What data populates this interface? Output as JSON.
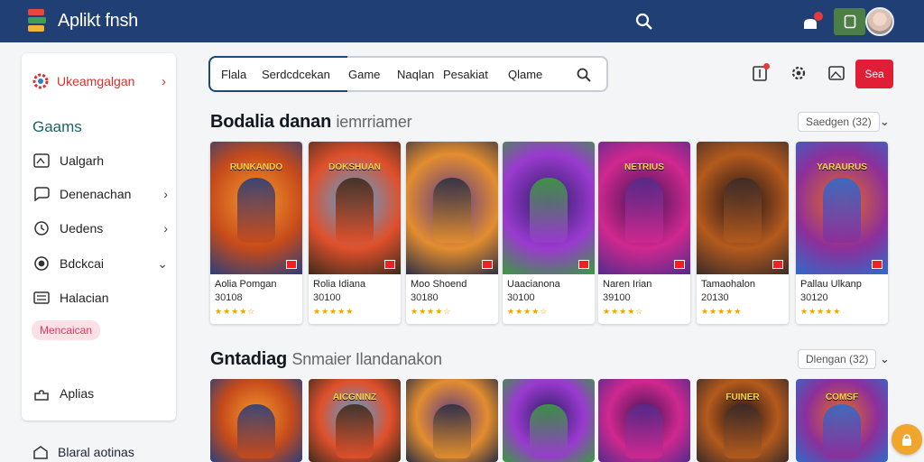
{
  "app": {
    "title": "Aplikt fnsh"
  },
  "colors": {
    "topbar": "#1f3f75",
    "accent_red": "#e01f36",
    "section_teal": "#18646c"
  },
  "sidebar": {
    "header": "Ukeamgalgan",
    "section": "Gaams",
    "items": [
      {
        "label": "Ualgarh",
        "icon": "image-icon"
      },
      {
        "label": "Denenachan",
        "icon": "chat-icon"
      },
      {
        "label": "Uedens",
        "icon": "clock-icon"
      },
      {
        "label": "Bdckcai",
        "icon": "record-icon"
      },
      {
        "label": "Halacian",
        "icon": "list-icon"
      }
    ],
    "pill": "Mencaican",
    "apps": "Aplias",
    "bottom": "Blaral aotinas"
  },
  "search": {
    "tabs": [
      "Flala",
      "Serdcdcekan",
      "Game",
      "Naqlan",
      "Pesakiat",
      "Qlame"
    ]
  },
  "toolbar": {
    "button_label": "Sea"
  },
  "section1": {
    "title": "Bodalia danan",
    "subtitle": "iemrriamer",
    "sort": "Saedgen (32)",
    "cards": [
      {
        "banner": "RUNKANDO",
        "name": "Aolia Pomgan",
        "num": "30108",
        "stars": "★★★★☆"
      },
      {
        "banner": "DOKSHUAN",
        "name": "Rolia Idiana",
        "num": "30100",
        "stars": "★★★★★"
      },
      {
        "banner": "",
        "name": "Moo Shoend",
        "num": "30180",
        "stars": "★★★★☆"
      },
      {
        "banner": "",
        "name": "Uaacianona",
        "num": "30100",
        "stars": "★★★★☆"
      },
      {
        "banner": "NETRIUS",
        "name": "Naren Irian",
        "num": "39100",
        "stars": "★★★★☆"
      },
      {
        "banner": "",
        "name": "Tamaohalon",
        "num": "20130",
        "stars": "★★★★★"
      },
      {
        "banner": "YARAURUS",
        "name": "Pallau Ulkanp",
        "num": "30120",
        "stars": "★★★★★"
      }
    ]
  },
  "section2": {
    "title": "Gntadiag",
    "subtitle": "Snmaier Ilandanakon",
    "sort": "Dlengan (32)",
    "cards": [
      {
        "banner": ""
      },
      {
        "banner": "AICGNINZ"
      },
      {
        "banner": ""
      },
      {
        "banner": ""
      },
      {
        "banner": ""
      },
      {
        "banner": "FUINER"
      },
      {
        "banner": "COMSF"
      }
    ]
  }
}
